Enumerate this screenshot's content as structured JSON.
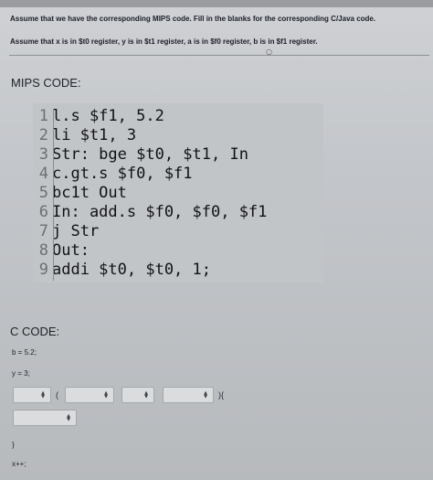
{
  "instructions": {
    "line1": "Assume that we have the corresponding MIPS code. Fill in the blanks for the corresponding C/Java code.",
    "line2": "Assume that x is in $t0 register, y is in $t1 register, a is in $f0 register, b is in $f1 register."
  },
  "mips": {
    "heading": "MIPS CODE:",
    "lines": [
      {
        "num": "1",
        "code": "l.s $f1, 5.2"
      },
      {
        "num": "2",
        "code": "li $t1, 3"
      },
      {
        "num": "3",
        "code": "Str: bge $t0, $t1, In"
      },
      {
        "num": "4",
        "code": "c.gt.s $f0, $f1"
      },
      {
        "num": "5",
        "code": "bc1t Out"
      },
      {
        "num": "6",
        "code": "In: add.s $f0, $f0, $f1"
      },
      {
        "num": "7",
        "code": "j Str"
      },
      {
        "num": "8",
        "code": "Out:"
      },
      {
        "num": "9",
        "code": "addi $t0, $t0, 1;"
      }
    ]
  },
  "c_code": {
    "heading": "C CODE:",
    "line_b": "b = 5.2;",
    "line_y": "y = 3;",
    "open_paren": "(",
    "close_brace_paren": "){",
    "closing_brace": "}",
    "line_x": "x++;"
  },
  "icons": {
    "dropdown_arrow": "up-down-arrows-icon",
    "small_mark": "circle-icon"
  }
}
